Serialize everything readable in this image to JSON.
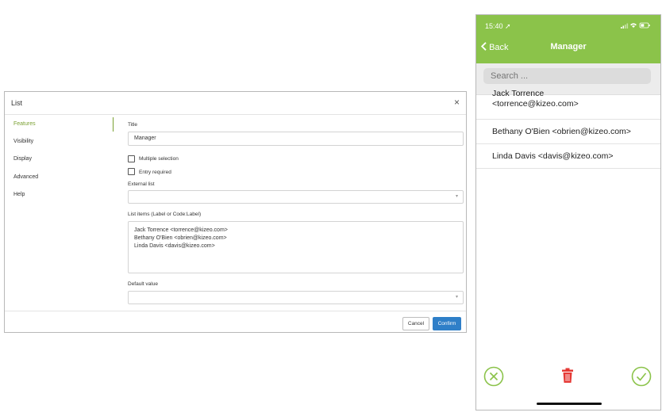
{
  "dialog": {
    "title": "List",
    "nav": [
      "Features",
      "Visibility",
      "Display",
      "Advanced",
      "Help"
    ],
    "title_label": "Title",
    "title_value": "Manager",
    "multiple_selection_label": "Multiple selection",
    "entry_required_label": "Entry required",
    "external_list_label": "External list",
    "list_items_label": "List items (Label or Code:Label)",
    "list_items": [
      "Jack Torrence <torrence@kizeo.com>",
      "Bethany O'Bien <obrien@kizeo.com>",
      "Linda Davis <davis@kizeo.com>"
    ],
    "default_value_label": "Default value",
    "cancel_label": "Cancel",
    "confirm_label": "Confirm",
    "accent_color": "#7aa032",
    "confirm_color": "#2f7fc8"
  },
  "phone": {
    "time": "15:40",
    "back_label": "Back",
    "title": "Manager",
    "search_placeholder": "Search ...",
    "items": [
      {
        "line1": "Jack Torrence",
        "line2": "<torrence@kizeo.com>"
      },
      {
        "line1": "Bethany O'Bien <obrien@kizeo.com>"
      },
      {
        "line1": "Linda Davis <davis@kizeo.com>"
      }
    ],
    "header_color": "#8bc34a",
    "delete_color": "#e53935"
  }
}
